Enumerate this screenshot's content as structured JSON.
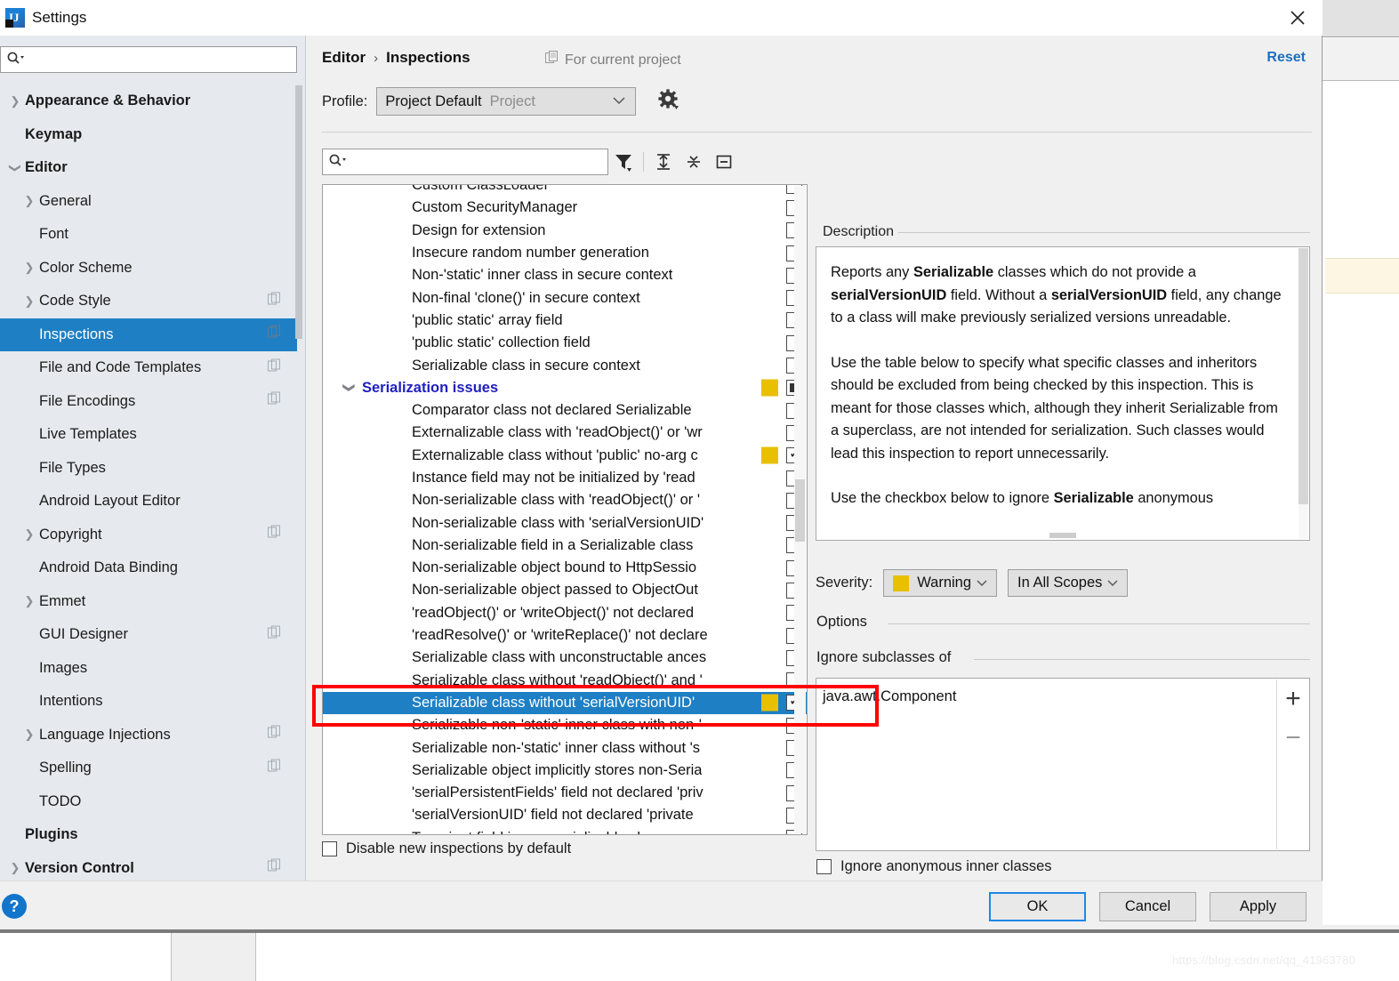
{
  "window": {
    "title": "Settings",
    "app_icon": "intellij-idea-icon",
    "close_icon": "close-icon"
  },
  "sidebar": {
    "search_placeholder": "",
    "search_icon": "search-icon",
    "items": [
      {
        "label": "Appearance & Behavior",
        "level": 0,
        "arrow": "collapsed",
        "copy": false,
        "selected": false
      },
      {
        "label": "Keymap",
        "level": 0,
        "arrow": "none",
        "copy": false,
        "selected": false
      },
      {
        "label": "Editor",
        "level": 0,
        "arrow": "expanded",
        "copy": false,
        "selected": false
      },
      {
        "label": "General",
        "level": 1,
        "arrow": "collapsed",
        "copy": false,
        "selected": false
      },
      {
        "label": "Font",
        "level": 1,
        "arrow": "none",
        "copy": false,
        "selected": false
      },
      {
        "label": "Color Scheme",
        "level": 1,
        "arrow": "collapsed",
        "copy": false,
        "selected": false
      },
      {
        "label": "Code Style",
        "level": 1,
        "arrow": "collapsed",
        "copy": true,
        "selected": false
      },
      {
        "label": "Inspections",
        "level": 1,
        "arrow": "none",
        "copy": true,
        "selected": true
      },
      {
        "label": "File and Code Templates",
        "level": 1,
        "arrow": "none",
        "copy": true,
        "selected": false
      },
      {
        "label": "File Encodings",
        "level": 1,
        "arrow": "none",
        "copy": true,
        "selected": false
      },
      {
        "label": "Live Templates",
        "level": 1,
        "arrow": "none",
        "copy": false,
        "selected": false
      },
      {
        "label": "File Types",
        "level": 1,
        "arrow": "none",
        "copy": false,
        "selected": false
      },
      {
        "label": "Android Layout Editor",
        "level": 1,
        "arrow": "none",
        "copy": false,
        "selected": false
      },
      {
        "label": "Copyright",
        "level": 1,
        "arrow": "collapsed",
        "copy": true,
        "selected": false
      },
      {
        "label": "Android Data Binding",
        "level": 1,
        "arrow": "none",
        "copy": false,
        "selected": false
      },
      {
        "label": "Emmet",
        "level": 1,
        "arrow": "collapsed",
        "copy": false,
        "selected": false
      },
      {
        "label": "GUI Designer",
        "level": 1,
        "arrow": "none",
        "copy": true,
        "selected": false
      },
      {
        "label": "Images",
        "level": 1,
        "arrow": "none",
        "copy": false,
        "selected": false
      },
      {
        "label": "Intentions",
        "level": 1,
        "arrow": "none",
        "copy": false,
        "selected": false
      },
      {
        "label": "Language Injections",
        "level": 1,
        "arrow": "collapsed",
        "copy": true,
        "selected": false
      },
      {
        "label": "Spelling",
        "level": 1,
        "arrow": "none",
        "copy": true,
        "selected": false
      },
      {
        "label": "TODO",
        "level": 1,
        "arrow": "none",
        "copy": false,
        "selected": false
      },
      {
        "label": "Plugins",
        "level": 0,
        "arrow": "none",
        "copy": false,
        "selected": false
      },
      {
        "label": "Version Control",
        "level": 0,
        "arrow": "collapsed",
        "copy": true,
        "selected": false
      }
    ]
  },
  "header": {
    "breadcrumb_root": "Editor",
    "breadcrumb_sep": "›",
    "breadcrumb_leaf": "Inspections",
    "for_current_project": "For current project",
    "for_current_project_icon": "copy-icon",
    "reset_label": "Reset",
    "profile_label": "Profile:",
    "profile_value": "Project Default",
    "profile_scope": "Project",
    "profile_chevron_icon": "chevron-down-icon",
    "profile_gear_icon": "gear-icon"
  },
  "toolbar": {
    "search_placeholder": "",
    "search_icon": "search-icon",
    "filter_icon": "filter-icon",
    "expand_all_icon": "expand-all-icon",
    "collapse_all_icon": "collapse-all-icon",
    "collapse_icon": "minus-box-icon"
  },
  "inspections": {
    "rows": [
      {
        "label": "Custom ClassLoader",
        "type": "child",
        "severity": null,
        "check": "empty",
        "selected": false,
        "clipped_top": true
      },
      {
        "label": "Custom SecurityManager",
        "type": "child",
        "severity": null,
        "check": "empty",
        "selected": false
      },
      {
        "label": "Design for extension",
        "type": "child",
        "severity": null,
        "check": "empty",
        "selected": false
      },
      {
        "label": "Insecure random number generation",
        "type": "child",
        "severity": null,
        "check": "empty",
        "selected": false
      },
      {
        "label": "Non-'static' inner class in secure context",
        "type": "child",
        "severity": null,
        "check": "empty",
        "selected": false
      },
      {
        "label": "Non-final 'clone()' in secure context",
        "type": "child",
        "severity": null,
        "check": "empty",
        "selected": false
      },
      {
        "label": "'public static' array field",
        "type": "child",
        "severity": null,
        "check": "empty",
        "selected": false
      },
      {
        "label": "'public static' collection field",
        "type": "child",
        "severity": null,
        "check": "empty",
        "selected": false
      },
      {
        "label": "Serializable class in secure context",
        "type": "child",
        "severity": null,
        "check": "empty",
        "selected": false
      },
      {
        "label": "Serialization issues",
        "type": "group",
        "severity": "#e8c000",
        "check": "partial",
        "selected": false
      },
      {
        "label": "Comparator class not declared Serializable",
        "type": "child",
        "severity": null,
        "check": "empty",
        "selected": false
      },
      {
        "label": "Externalizable class with 'readObject()' or 'wr",
        "type": "child",
        "severity": null,
        "check": "empty",
        "selected": false
      },
      {
        "label": "Externalizable class without 'public' no-arg c",
        "type": "child",
        "severity": "#e8c000",
        "check": "checked",
        "selected": false
      },
      {
        "label": "Instance field may not be initialized by 'read",
        "type": "child",
        "severity": null,
        "check": "empty",
        "selected": false
      },
      {
        "label": "Non-serializable class with 'readObject()' or '",
        "type": "child",
        "severity": null,
        "check": "empty",
        "selected": false
      },
      {
        "label": "Non-serializable class with 'serialVersionUID'",
        "type": "child",
        "severity": null,
        "check": "empty",
        "selected": false
      },
      {
        "label": "Non-serializable field in a Serializable class",
        "type": "child",
        "severity": null,
        "check": "empty",
        "selected": false
      },
      {
        "label": "Non-serializable object bound to HttpSessio",
        "type": "child",
        "severity": null,
        "check": "empty",
        "selected": false
      },
      {
        "label": "Non-serializable object passed to ObjectOut",
        "type": "child",
        "severity": null,
        "check": "empty",
        "selected": false
      },
      {
        "label": "'readObject()' or 'writeObject()' not declared",
        "type": "child",
        "severity": null,
        "check": "empty",
        "selected": false
      },
      {
        "label": "'readResolve()' or 'writeReplace()' not declare",
        "type": "child",
        "severity": null,
        "check": "empty",
        "selected": false
      },
      {
        "label": "Serializable class with unconstructable ances",
        "type": "child",
        "severity": null,
        "check": "empty",
        "selected": false
      },
      {
        "label": "Serializable class without 'readObject()' and '",
        "type": "child",
        "severity": null,
        "check": "empty",
        "selected": false
      },
      {
        "label": "Serializable class without 'serialVersionUID'",
        "type": "child",
        "severity": "#e8c000",
        "check": "checked",
        "selected": true
      },
      {
        "label": "Serializable non-'static' inner class with non-'",
        "type": "child",
        "severity": null,
        "check": "empty",
        "selected": false
      },
      {
        "label": "Serializable non-'static' inner class without 's",
        "type": "child",
        "severity": null,
        "check": "empty",
        "selected": false
      },
      {
        "label": "Serializable object implicitly stores non-Seria",
        "type": "child",
        "severity": null,
        "check": "empty",
        "selected": false
      },
      {
        "label": "'serialPersistentFields' field not declared 'priv",
        "type": "child",
        "severity": null,
        "check": "empty",
        "selected": false
      },
      {
        "label": "'serialVersionUID' field not declared 'private",
        "type": "child",
        "severity": null,
        "check": "empty",
        "selected": false
      },
      {
        "label": "Transient field in non-serializable class",
        "type": "child",
        "severity": null,
        "check": "empty",
        "selected": false
      }
    ],
    "disable_new_label": "Disable new inspections by default",
    "disable_new_checked": false
  },
  "description": {
    "title": "Description",
    "paragraphs": [
      [
        {
          "t": "Reports any ",
          "b": false
        },
        {
          "t": "Serializable",
          "b": true
        },
        {
          "t": " classes which do not provide a ",
          "b": false
        },
        {
          "t": "serialVersionUID",
          "b": true
        },
        {
          "t": " field. Without a ",
          "b": false
        },
        {
          "t": "serialVersionUID",
          "b": true
        },
        {
          "t": " field, any change to a class will make previously serialized versions unreadable.",
          "b": false
        }
      ],
      [
        {
          "t": "Use the table below to specify what specific classes and inheritors should be excluded from being checked by this inspection. This is meant for those classes which, although they inherit Serializable from a superclass, are not intended for serialization. Such classes would lead this inspection to report unnecessarily.",
          "b": false
        }
      ],
      [
        {
          "t": "Use the checkbox below to ignore ",
          "b": false
        },
        {
          "t": "Serializable",
          "b": true
        },
        {
          "t": " anonymous",
          "b": false
        }
      ]
    ]
  },
  "options": {
    "severity_label": "Severity:",
    "severity_value": "Warning",
    "severity_color": "#e8c000",
    "scope_value": "In All Scopes",
    "options_title": "Options",
    "ignore_subclasses_title": "Ignore subclasses of",
    "ignore_subclasses_items": [
      "java.awt.Component"
    ],
    "add_button": "+",
    "remove_button": "−",
    "ignore_anonymous_label": "Ignore anonymous inner classes",
    "ignore_anonymous_checked": false
  },
  "footer": {
    "help_icon": "help-icon",
    "ok_label": "OK",
    "cancel_label": "Cancel",
    "apply_label": "Apply"
  },
  "watermark": {
    "text": "https://blog.csdn.net/qq_41963780"
  }
}
